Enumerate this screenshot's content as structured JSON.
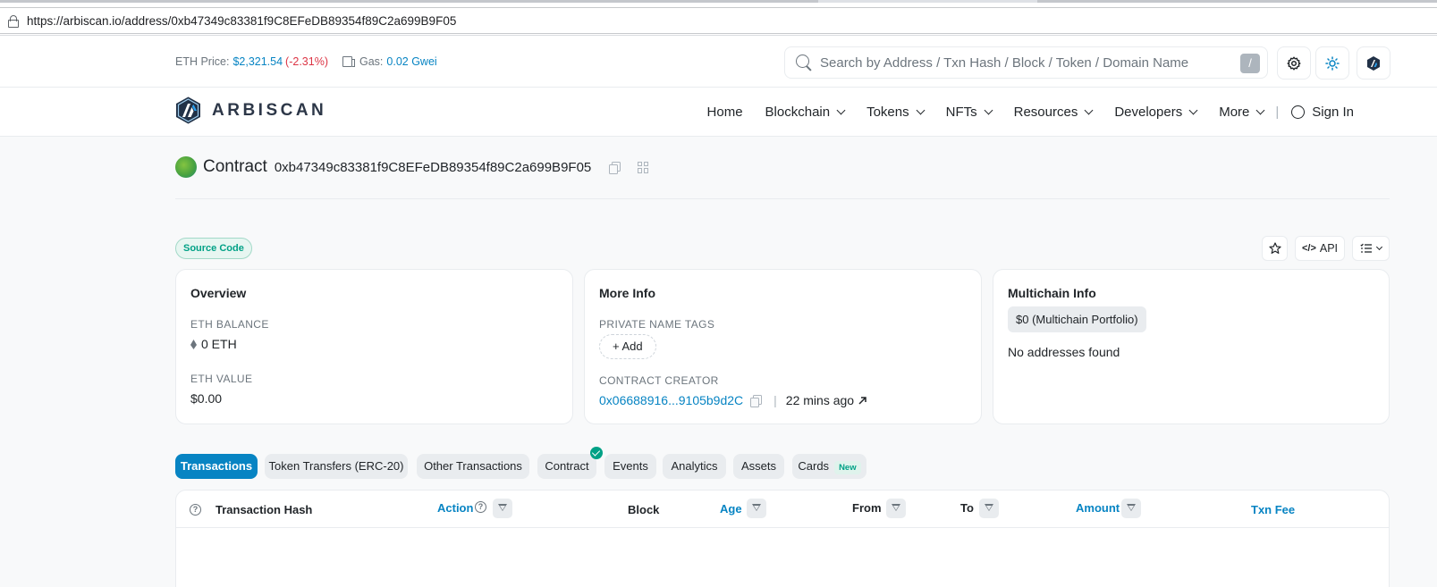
{
  "browser": {
    "url": "https://arbiscan.io/address/0xb47349c83381f9C8EFeDB89354f89C2a699B9F05"
  },
  "topbar": {
    "eth_price_label": "ETH Price:",
    "eth_price_value": "$2,321.54",
    "eth_price_change": "(-2.31%)",
    "gas_label": "Gas:",
    "gas_value": "0.02 Gwei",
    "search_placeholder": "Search by Address / Txn Hash / Block / Token / Domain Name",
    "search_shortcut": "/"
  },
  "nav": {
    "brand": "ARBISCAN",
    "items": [
      "Home",
      "Blockchain",
      "Tokens",
      "NFTs",
      "Resources",
      "Developers",
      "More"
    ],
    "separator": "|",
    "sign_in": "Sign In"
  },
  "page": {
    "title": "Contract",
    "address": "0xb47349c83381f9C8EFeDB89354f89C2a699B9F05",
    "source_badge": "Source Code",
    "api_label": "API"
  },
  "cards": {
    "overview": {
      "title": "Overview",
      "balance_label": "ETH BALANCE",
      "balance_value": "0 ETH",
      "value_label": "ETH VALUE",
      "value_value": "$0.00"
    },
    "more_info": {
      "title": "More Info",
      "tags_label": "PRIVATE NAME TAGS",
      "add_label": "+ Add",
      "creator_label": "CONTRACT CREATOR",
      "creator_address": "0x06688916...9105b9d2C",
      "sep": "|",
      "creator_age": "22 mins ago"
    },
    "multichain": {
      "title": "Multichain Info",
      "portfolio_badge": "$0 (Multichain Portfolio)",
      "empty_text": "No addresses found"
    }
  },
  "tabs": [
    {
      "label": "Transactions",
      "active": true
    },
    {
      "label": "Token Transfers (ERC-20)",
      "active": false
    },
    {
      "label": "Other Transactions",
      "active": false
    },
    {
      "label": "Contract",
      "active": false
    },
    {
      "label": "Events",
      "active": false
    },
    {
      "label": "Analytics",
      "active": false
    },
    {
      "label": "Assets",
      "active": false
    },
    {
      "label": "Cards",
      "active": false,
      "badge": "New"
    }
  ],
  "table": {
    "columns": [
      "Transaction Hash",
      "Action",
      "Block",
      "Age",
      "From",
      "To",
      "Amount",
      "Txn Fee"
    ],
    "help_glyph": "?"
  },
  "colors": {
    "accent": "#0784c3",
    "negative": "#dc3545",
    "success": "#00a186"
  }
}
